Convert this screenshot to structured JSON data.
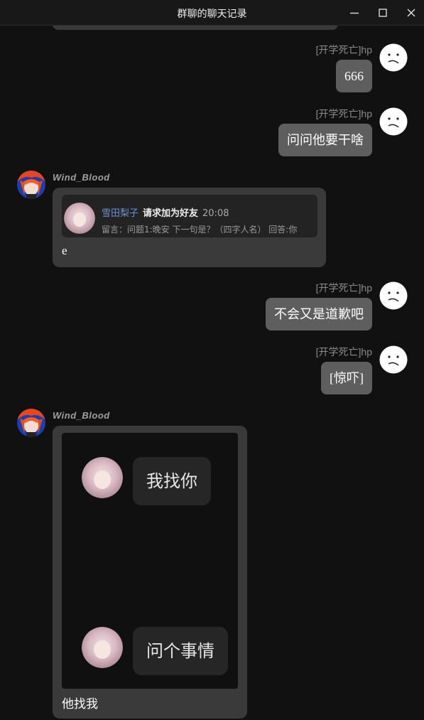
{
  "window": {
    "title": "群聊的聊天记录",
    "controls": [
      "minimize-icon",
      "maximize-icon",
      "close-icon"
    ]
  },
  "messages": [
    {
      "sender": "[开学死亡]hp",
      "side": "right",
      "text": "666"
    },
    {
      "sender": "[开学死亡]hp",
      "side": "right",
      "text": "问问他要干啥"
    },
    {
      "sender": "Wind_Blood",
      "side": "left",
      "friend_request": {
        "name": "雪田梨子",
        "action": "请求加为好友",
        "time": "20:08",
        "note": "留言：问题1:晚安 下一句是？（四字人名） 回答:你"
      },
      "text": "e"
    },
    {
      "sender": "[开学死亡]hp",
      "side": "right",
      "text": "不会又是道歉吧"
    },
    {
      "sender": "[开学死亡]hp",
      "side": "right",
      "text": "[惊吓]"
    },
    {
      "sender": "Wind_Blood",
      "side": "left",
      "image_messages": [
        "我找你",
        "问个事情"
      ],
      "text": "他找我"
    }
  ]
}
